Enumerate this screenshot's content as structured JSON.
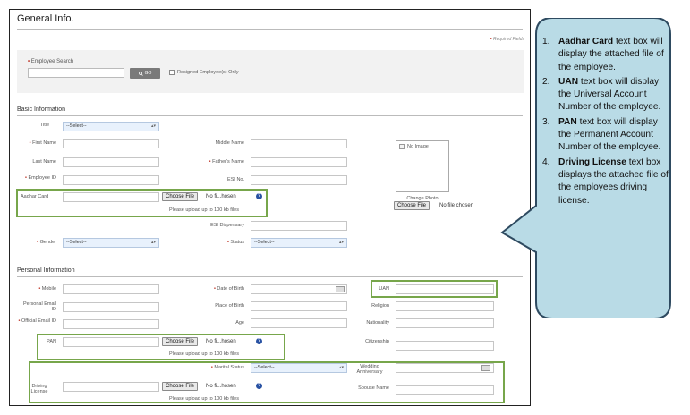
{
  "form": {
    "title": "General Info.",
    "required_note": "Required Fields",
    "search": {
      "label": "Employee Search",
      "input_value": "",
      "go_label": "GO",
      "resigned_label": "Resigned Employee(s) Only"
    },
    "basic_info": {
      "heading": "Basic Information",
      "title_label": "Title",
      "title_value": "--Select--",
      "first_name_label": "First Name",
      "middle_name_label": "Middle Name",
      "last_name_label": "Last Name",
      "fathers_name_label": "Father's Name",
      "employee_id_label": "Employee ID",
      "esi_no_label": "ESI No.",
      "aadhar_label": "Aadhar Card",
      "aadhar_file_button": "Choose File",
      "aadhar_file_text": "No fi...hosen",
      "upload_hint": "Please upload up to 100 kb files",
      "esi_dispensary_label": "ESI Dispensary",
      "gender_label": "Gender",
      "gender_value": "--Select--",
      "status_label": "Status",
      "status_value": "--Select--",
      "photo_alt": "No Image",
      "change_photo_label": "Change Photo",
      "photo_file_button": "Choose File",
      "photo_file_text": "No file chosen"
    },
    "personal_info": {
      "heading": "Personal Information",
      "mobile_label": "Mobile",
      "dob_label": "Date of Birth",
      "uan_label": "UAN",
      "personal_email_label": "Personal Email ID",
      "place_of_birth_label": "Place of Birth",
      "religion_label": "Religion",
      "official_email_label": "Official Email ID",
      "age_label": "Age",
      "nationality_label": "Nationality",
      "pan_label": "PAN",
      "pan_file_button": "Choose File",
      "pan_file_text": "No fi...hosen",
      "pan_hint": "Please upload up to 100 kb files",
      "citizenship_label": "Citizenship",
      "marital_status_label": "Marital Status",
      "marital_status_value": "--Select--",
      "wedding_anniversary_label": "Wedding Anniversary",
      "driving_license_label": "Driving License",
      "dl_file_button": "Choose File",
      "dl_file_text": "No fi...hosen",
      "dl_hint": "Please upload up to 100 kb files",
      "spouse_name_label": "Spouse Name"
    }
  },
  "callout": {
    "items": [
      {
        "num": "1.",
        "bold": "Aadhar Card",
        "text": " text box will display the attached file of the employee."
      },
      {
        "num": "2.",
        "bold": "UAN",
        "text": " text box will display the Universal Account Number of the employee."
      },
      {
        "num": "3.",
        "bold": "PAN",
        "text": " text box will display the Permanent Account Number of the employee."
      },
      {
        "num": "4.",
        "bold": "Driving License",
        "text": " text box displays the attached file of the employees driving license."
      }
    ]
  },
  "colors": {
    "highlight_border": "#77a64b",
    "callout_fill": "#b9dbe6",
    "callout_border": "#2e4a60",
    "required_star": "#c0392b"
  }
}
